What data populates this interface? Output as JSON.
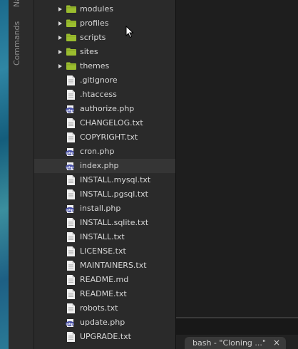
{
  "sidebar": {
    "tabs": [
      "Na",
      "Commands"
    ]
  },
  "file_tree": {
    "items": [
      {
        "label": "modules",
        "kind": "folder",
        "expandable": true
      },
      {
        "label": "profiles",
        "kind": "folder",
        "expandable": true
      },
      {
        "label": "scripts",
        "kind": "folder",
        "expandable": true
      },
      {
        "label": "sites",
        "kind": "folder",
        "expandable": true
      },
      {
        "label": "themes",
        "kind": "folder",
        "expandable": true
      },
      {
        "label": ".gitignore",
        "kind": "file"
      },
      {
        "label": ".htaccess",
        "kind": "file"
      },
      {
        "label": "authorize.php",
        "kind": "php"
      },
      {
        "label": "CHANGELOG.txt",
        "kind": "file"
      },
      {
        "label": "COPYRIGHT.txt",
        "kind": "file"
      },
      {
        "label": "cron.php",
        "kind": "php"
      },
      {
        "label": "index.php",
        "kind": "php",
        "selected": true
      },
      {
        "label": "INSTALL.mysql.txt",
        "kind": "file"
      },
      {
        "label": "INSTALL.pgsql.txt",
        "kind": "file"
      },
      {
        "label": "install.php",
        "kind": "php"
      },
      {
        "label": "INSTALL.sqlite.txt",
        "kind": "file"
      },
      {
        "label": "INSTALL.txt",
        "kind": "file"
      },
      {
        "label": "LICENSE.txt",
        "kind": "file"
      },
      {
        "label": "MAINTAINERS.txt",
        "kind": "file"
      },
      {
        "label": "README.md",
        "kind": "file"
      },
      {
        "label": "README.txt",
        "kind": "file"
      },
      {
        "label": "robots.txt",
        "kind": "file"
      },
      {
        "label": "update.php",
        "kind": "php"
      },
      {
        "label": "UPGRADE.txt",
        "kind": "file"
      }
    ]
  },
  "terminal": {
    "tab_label": "bash - \"Cloning ...\"",
    "close_glyph": "×"
  },
  "colors": {
    "folder": "#9bbd2f",
    "php_badge": "#4a52a8",
    "selected_row": "#353535"
  }
}
